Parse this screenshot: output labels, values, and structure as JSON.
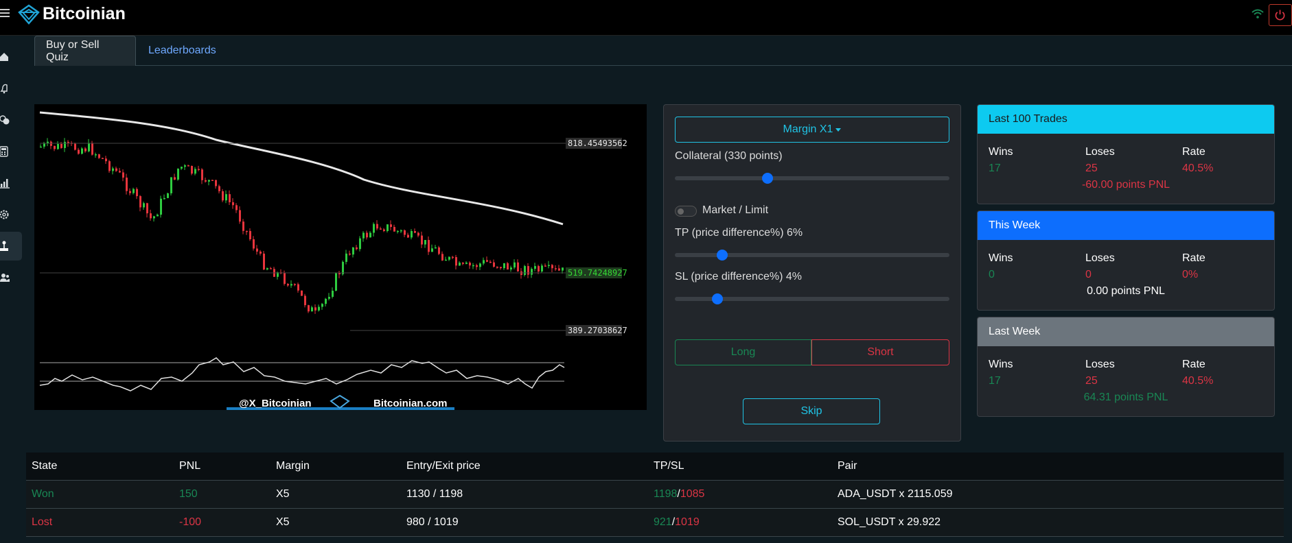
{
  "app": {
    "title": "Bitcoinian"
  },
  "tabs": [
    {
      "label": "Buy or Sell Quiz",
      "active": true
    },
    {
      "label": "Leaderboards",
      "active": false
    }
  ],
  "sidebar": {
    "items": [
      {
        "icon": "home-icon"
      },
      {
        "icon": "bell-icon"
      },
      {
        "icon": "coins-icon"
      },
      {
        "icon": "calculator-icon"
      },
      {
        "icon": "bar-chart-icon"
      },
      {
        "icon": "gear-icon"
      },
      {
        "icon": "joystick-icon",
        "active": true
      },
      {
        "icon": "users-icon"
      }
    ]
  },
  "chart": {
    "price_levels": [
      "818.45493562",
      "519.74248927",
      "389.27038627"
    ],
    "watermark_left": "@X_Bitcoinian",
    "watermark_right": "Bitcoinian.com"
  },
  "form": {
    "margin_label": "Margin X1",
    "collateral_label": "Collateral (330 points)",
    "collateral_fraction": 0.33,
    "market_limit_label": "Market / Limit",
    "tp_label": "TP (price difference%) 6%",
    "tp_fraction": 0.16,
    "sl_label": "SL (price difference%) 4%",
    "sl_fraction": 0.14,
    "long_label": "Long",
    "short_label": "Short",
    "skip_label": "Skip"
  },
  "stats": [
    {
      "title": "Last 100 Trades",
      "header_color": "#0dcaf0",
      "header_text_color": "#1a1a1a",
      "wins_label": "Wins",
      "loses_label": "Loses",
      "rate_label": "Rate",
      "wins": "17",
      "loses": "25",
      "rate": "40.5%",
      "pnl": "-60.00 points PNL",
      "pnl_color": "red"
    },
    {
      "title": "This Week",
      "header_color": "#0d6efd",
      "header_text_color": "#ffffff",
      "wins_label": "Wins",
      "loses_label": "Loses",
      "rate_label": "Rate",
      "wins": "0",
      "loses": "0",
      "rate": "0%",
      "pnl": "0.00 points PNL",
      "pnl_color": "white"
    },
    {
      "title": "Last Week",
      "header_color": "#6c757d",
      "header_text_color": "#ffffff",
      "wins_label": "Wins",
      "loses_label": "Loses",
      "rate_label": "Rate",
      "wins": "17",
      "loses": "25",
      "rate": "40.5%",
      "pnl": "64.31 points PNL",
      "pnl_color": "green"
    }
  ],
  "table": {
    "headers": [
      "State",
      "PNL",
      "Margin",
      "Entry/Exit price",
      "TP/SL",
      "Pair"
    ],
    "rows": [
      {
        "state": "Won",
        "pnl": "150",
        "margin": "X5",
        "entry_exit": "1130 / 1198",
        "tp": "1198",
        "sl": "1085",
        "pair": "ADA_USDT x 2115.059",
        "color": "green"
      },
      {
        "state": "Lost",
        "pnl": "-100",
        "margin": "X5",
        "entry_exit": "980 / 1019",
        "tp": "921",
        "sl": "1019",
        "pair": "SOL_USDT x 29.922",
        "color": "red"
      }
    ]
  }
}
